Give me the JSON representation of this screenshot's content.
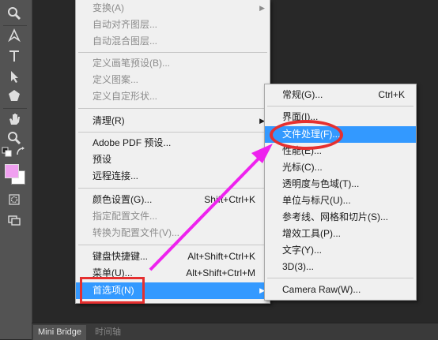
{
  "main_menu": {
    "items": [
      {
        "label": "变换(A)",
        "shortcut": "",
        "submenu": true,
        "disabled": true
      },
      {
        "label": "自动对齐图层...",
        "shortcut": "",
        "submenu": false,
        "disabled": true
      },
      {
        "label": "自动混合图层...",
        "shortcut": "",
        "submenu": false,
        "disabled": true
      },
      {
        "label": "定义画笔预设(B)...",
        "shortcut": "",
        "submenu": false,
        "disabled": true
      },
      {
        "label": "定义图案...",
        "shortcut": "",
        "submenu": false,
        "disabled": true
      },
      {
        "label": "定义自定形状...",
        "shortcut": "",
        "submenu": false,
        "disabled": true
      },
      {
        "label": "清理(R)",
        "shortcut": "",
        "submenu": true,
        "disabled": false
      },
      {
        "label": "Adobe PDF 预设...",
        "shortcut": "",
        "submenu": false,
        "disabled": false
      },
      {
        "label": "预设",
        "shortcut": "",
        "submenu": false,
        "disabled": false
      },
      {
        "label": "远程连接...",
        "shortcut": "",
        "submenu": false,
        "disabled": false
      },
      {
        "label": "颜色设置(G)...",
        "shortcut": "Shift+Ctrl+K",
        "submenu": false,
        "disabled": false
      },
      {
        "label": "指定配置文件...",
        "shortcut": "",
        "submenu": false,
        "disabled": true
      },
      {
        "label": "转换为配置文件(V)...",
        "shortcut": "",
        "submenu": false,
        "disabled": true
      },
      {
        "label": "键盘快捷键...",
        "shortcut": "Alt+Shift+Ctrl+K",
        "submenu": false,
        "disabled": false
      },
      {
        "label": "菜单(U)...",
        "shortcut": "Alt+Shift+Ctrl+M",
        "submenu": false,
        "disabled": false
      },
      {
        "label": "首选项(N)",
        "shortcut": "",
        "submenu": true,
        "disabled": false,
        "active": true
      }
    ]
  },
  "submenu": {
    "items": [
      {
        "label": "常规(G)...",
        "shortcut": "Ctrl+K"
      },
      {
        "label": "界面(I)...",
        "shortcut": ""
      },
      {
        "label": "文件处理(F)...",
        "shortcut": "",
        "active": true
      },
      {
        "label": "性能(E)...",
        "shortcut": ""
      },
      {
        "label": "光标(C)...",
        "shortcut": ""
      },
      {
        "label": "透明度与色域(T)...",
        "shortcut": ""
      },
      {
        "label": "单位与标尺(U)...",
        "shortcut": ""
      },
      {
        "label": "参考线、网格和切片(S)...",
        "shortcut": ""
      },
      {
        "label": "增效工具(P)...",
        "shortcut": ""
      },
      {
        "label": "文字(Y)...",
        "shortcut": ""
      },
      {
        "label": "3D(3)...",
        "shortcut": ""
      },
      {
        "label": "Camera Raw(W)...",
        "shortcut": ""
      }
    ]
  },
  "bottom_panel": {
    "tabs": [
      {
        "label": "Mini Bridge",
        "active": true
      },
      {
        "label": "时间轴",
        "active": false
      }
    ]
  },
  "colors": {
    "foreground": "#f0a0f0",
    "background": "#ffffff",
    "highlight": "#3399ff",
    "annotation": "#e53030",
    "arrow": "#ee22ee"
  }
}
